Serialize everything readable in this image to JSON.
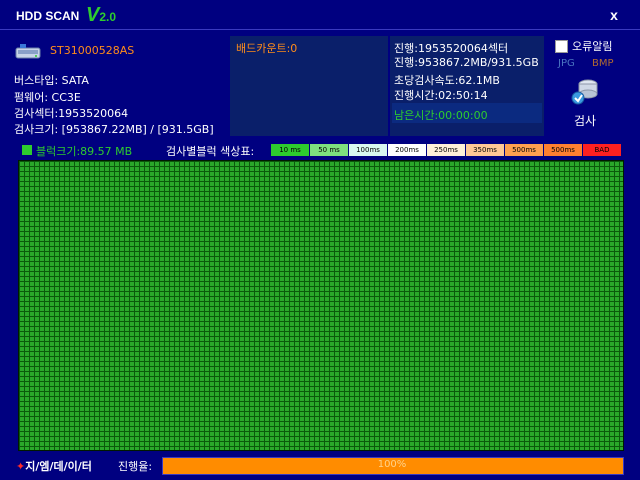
{
  "title": {
    "name": "HDD SCAN",
    "v": "V",
    "version": "2.0",
    "close": "x"
  },
  "drive": {
    "model": "ST31000528AS",
    "bus_type": "버스타입: SATA",
    "firmware": "펌웨어: CC3E",
    "scan_sectors": "검사섹터:1953520064",
    "scan_size": "검사크기: [953867.22MB] / [931.5GB]"
  },
  "bad_count": "배드카운트:0",
  "progress_panel": {
    "sectors": "진행:1953520064섹터",
    "size": "진행:953867.2MB/931.5GB",
    "speed": "초당검사속도:62.1MB",
    "elapsed": "진행시간:02:50:14",
    "remaining": "남은시간:00:00:00"
  },
  "options": {
    "error_alarm": "오류알림",
    "jpg": "JPG",
    "bmp": "BMP",
    "scan_button": "검사"
  },
  "legend": {
    "block_size": "블럭크기:89.57 MB",
    "label": "검사별블럭 색상표:",
    "items": [
      {
        "label": "10 ms",
        "color": "#2ecc2e"
      },
      {
        "label": "50 ms",
        "color": "#7ee07e"
      },
      {
        "label": "100ms",
        "color": "#d8f8f0"
      },
      {
        "label": "200ms",
        "color": "#ffffff"
      },
      {
        "label": "250ms",
        "color": "#fff0d8"
      },
      {
        "label": "350ms",
        "color": "#ffc896"
      },
      {
        "label": "500ms",
        "color": "#ffa050"
      },
      {
        "label": "500ms",
        "color": "#ff8030"
      },
      {
        "label": "BAD",
        "color": "#ff2020"
      }
    ]
  },
  "footer": {
    "brand_star": "✦",
    "brand": "지/엠/데/이/터",
    "progress_label": "진행율:",
    "progress_value": 1.0,
    "progress_text": "100%"
  },
  "colors": {
    "background": "#000080",
    "accent_green": "#2ecc2e",
    "accent_orange": "#ff8c00",
    "grid_block": "#2aa82a"
  }
}
